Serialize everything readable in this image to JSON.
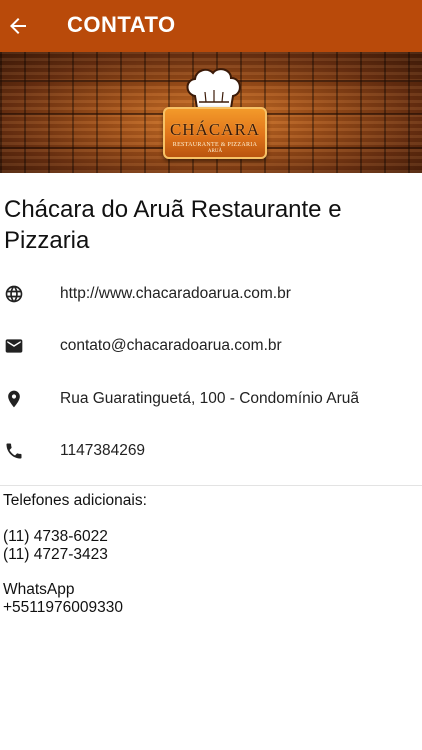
{
  "appbar": {
    "title": "CONTATO",
    "color": "#b94a0a"
  },
  "banner": {
    "logo_main": "CHÁCARA",
    "logo_sub": "RESTAURANTE & PIZZARIA",
    "logo_tag": "ARUÃ"
  },
  "business_name": "Chácara do Aruã Restaurante e Pizzaria",
  "contacts": {
    "website": "http://www.chacaradoarua.com.br",
    "email": "contato@chacaradoarua.com.br",
    "address": "Rua Guaratinguetá, 100 - Condomínio Aruã",
    "phone": "1147384269"
  },
  "additional": {
    "heading": "Telefones adicionais:",
    "phones": [
      "(11) 4738-6022",
      "(11) 4727-3423"
    ],
    "whatsapp_label": "WhatsApp",
    "whatsapp_number": "+5511976009330"
  },
  "icons": {
    "back": "arrow-back-icon",
    "website": "globe-icon",
    "email": "envelope-icon",
    "address": "map-pin-icon",
    "phone": "phone-icon"
  }
}
